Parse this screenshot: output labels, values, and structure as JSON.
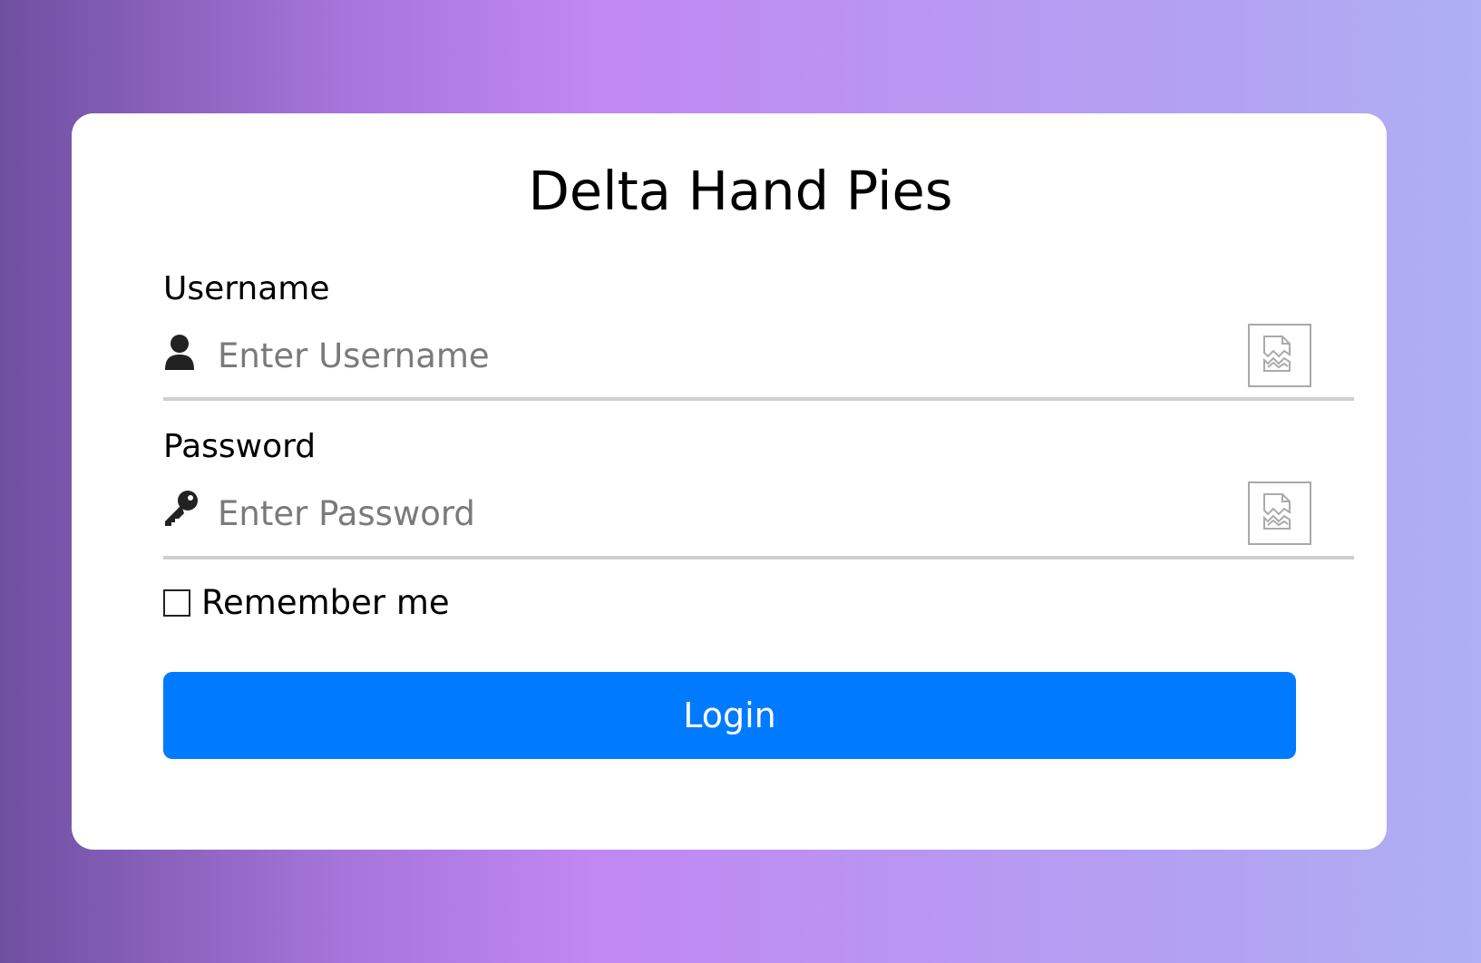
{
  "app": {
    "title": "Delta Hand Pies"
  },
  "form": {
    "username": {
      "label": "Username",
      "placeholder": "Enter Username",
      "value": "",
      "icon": "user-icon",
      "trailing_icon": "broken-image-icon"
    },
    "password": {
      "label": "Password",
      "placeholder": "Enter Password",
      "value": "",
      "icon": "key-icon",
      "trailing_icon": "broken-image-icon"
    },
    "remember": {
      "label": "Remember me",
      "checked": false
    },
    "submit": {
      "label": "Login"
    }
  },
  "colors": {
    "button": "#007bff",
    "background_start": "#6f4fa0",
    "background_end": "#aeb0f3",
    "card": "#ffffff"
  }
}
